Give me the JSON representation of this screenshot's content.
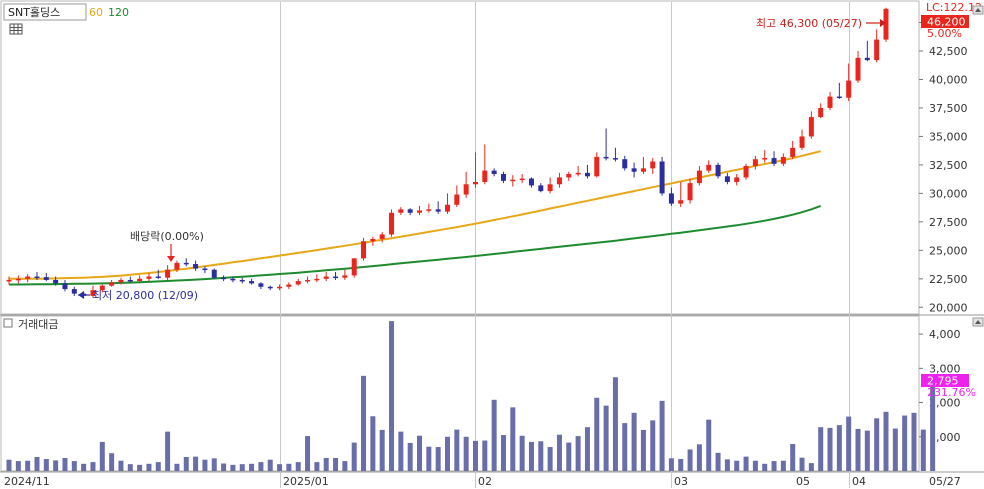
{
  "header": {
    "stock_name": "SNT홀딩스",
    "ma_labels": [
      {
        "text": "60",
        "color": "#e6a817"
      },
      {
        "text": "120",
        "color": "#1e8c2e"
      }
    ],
    "grid_icon": "table-icon"
  },
  "price_panel": {
    "lc_label": "LC:122.12",
    "current_price_tag": "46,200",
    "change_pct_tag": "5.00%",
    "high_annotation": "최고 46,300 (05/27)",
    "low_annotation": "최저 20,800 (12/09)",
    "dividend_annotation": "배당락(0.00%)"
  },
  "volume_panel": {
    "title": "거래대금",
    "current_value_tag": "2,795",
    "ratio_tag": "231.76%"
  },
  "colors": {
    "up": "#e8261e",
    "down": "#2b2f9e",
    "ma60": "#e6a817",
    "ma120": "#1e8c2e",
    "volume": "#6a6ea8",
    "tag_price": "#e8261e",
    "tag_volume": "#ee22ee"
  },
  "chart_data": [
    {
      "type": "candlestick",
      "title": "SNT홀딩스",
      "ylim": [
        19500,
        46800
      ],
      "y_ticks": [
        "20,000",
        "22,500",
        "25,000",
        "27,500",
        "30,000",
        "32,500",
        "35,000",
        "37,500",
        "40,000",
        "42,500",
        "45,000"
      ],
      "x_tick_labels": [
        "2024/11",
        "2025/01",
        "02",
        "03",
        "04",
        "05",
        "05/27"
      ],
      "series": [
        {
          "name": "60",
          "values": [
            22500,
            22500,
            22500,
            22510,
            22520,
            22540,
            22560,
            22580,
            22600,
            22630,
            22670,
            22720,
            22780,
            22850,
            22930,
            23010,
            23100,
            23190,
            23290,
            23390,
            23500,
            23600,
            23720,
            23830,
            23950,
            24060,
            24180,
            24300,
            24420,
            24540,
            24660,
            24780,
            24900,
            25020,
            25150,
            25270,
            25400,
            25530,
            25660,
            25800,
            25930,
            26060,
            26200,
            26340,
            26480,
            26620,
            26760,
            26900,
            27040,
            27190,
            27340,
            27500,
            27660,
            27820,
            27990,
            28150,
            28320,
            28490,
            28670,
            28840,
            29010,
            29180,
            29350,
            29520,
            29690,
            29860,
            30030,
            30200,
            30370,
            30540,
            30710,
            30880,
            31050,
            31220,
            31390,
            31560,
            31730,
            31900,
            32070,
            32240,
            32410,
            32580,
            32750,
            32920,
            33100,
            33300,
            33500,
            33700
          ]
        },
        {
          "name": "120",
          "values": [
            22000,
            22000,
            22010,
            22020,
            22030,
            22040,
            22050,
            22060,
            22070,
            22080,
            22100,
            22120,
            22140,
            22170,
            22200,
            22230,
            22270,
            22310,
            22350,
            22390,
            22430,
            22480,
            22530,
            22580,
            22630,
            22680,
            22740,
            22800,
            22860,
            22920,
            22980,
            23040,
            23110,
            23180,
            23250,
            23320,
            23390,
            23460,
            23540,
            23620,
            23700,
            23780,
            23860,
            23940,
            24020,
            24100,
            24180,
            24260,
            24340,
            24420,
            24500,
            24590,
            24680,
            24770,
            24860,
            24950,
            25040,
            25130,
            25220,
            25310,
            25400,
            25490,
            25580,
            25670,
            25760,
            25850,
            25950,
            26050,
            26150,
            26250,
            26350,
            26450,
            26550,
            26650,
            26760,
            26870,
            26980,
            27090,
            27200,
            27330,
            27460,
            27600,
            27760,
            27940,
            28130,
            28350,
            28600,
            28900
          ]
        }
      ],
      "candles": {
        "open": [
          22300,
          22400,
          22500,
          22700,
          22650,
          22400,
          22100,
          21600,
          21200,
          21000,
          21500,
          21900,
          22200,
          22400,
          22300,
          22500,
          22700,
          22600,
          23300,
          23900,
          23800,
          23400,
          23300,
          22600,
          22500,
          22400,
          22300,
          22100,
          21800,
          21700,
          21800,
          22000,
          22300,
          22400,
          22500,
          22700,
          22600,
          22800,
          24300,
          25800,
          26000,
          26400,
          28300,
          28600,
          28300,
          28500,
          28600,
          28400,
          29000,
          29900,
          30800,
          31000,
          32000,
          31700,
          31100,
          31200,
          31300,
          30700,
          30200,
          30800,
          31400,
          31700,
          31800,
          31500,
          33200,
          33100,
          33000,
          32200,
          31900,
          32200,
          32800,
          30000,
          29100,
          29400,
          30900,
          32000,
          32500,
          31500,
          31000,
          31400,
          32400,
          33000,
          33100,
          32600,
          33200,
          34000,
          35000,
          36700,
          37500,
          38500,
          38400,
          39900,
          41900,
          41700,
          43500
        ],
        "high": [
          22700,
          22800,
          22900,
          23100,
          23000,
          22700,
          22400,
          21800,
          21400,
          21900,
          22000,
          22400,
          22600,
          22700,
          22800,
          23000,
          23300,
          23700,
          24100,
          24300,
          24100,
          23600,
          23400,
          22800,
          22700,
          22600,
          22500,
          22200,
          21900,
          22000,
          22200,
          22500,
          22700,
          22900,
          23100,
          23100,
          23300,
          24300,
          26100,
          26200,
          26600,
          28600,
          28800,
          28700,
          28900,
          29100,
          29300,
          30000,
          30700,
          31900,
          33600,
          34300,
          32200,
          31900,
          31600,
          31700,
          31400,
          30900,
          31400,
          31800,
          31900,
          32400,
          32500,
          33600,
          35700,
          34000,
          33300,
          32700,
          33200,
          33100,
          33200,
          30500,
          31000,
          31300,
          32400,
          32900,
          32700,
          31800,
          31700,
          32600,
          33300,
          33800,
          33700,
          33500,
          34600,
          35600,
          37200,
          37900,
          38900,
          39700,
          41400,
          42500,
          43400,
          44400,
          46300
        ],
        "low": [
          22000,
          22100,
          22200,
          22400,
          22300,
          21900,
          21400,
          21000,
          20800,
          20900,
          21300,
          21800,
          22000,
          22200,
          22100,
          22300,
          22500,
          22400,
          23100,
          23600,
          23200,
          23000,
          22500,
          22300,
          22200,
          22100,
          22000,
          21600,
          21500,
          21500,
          21600,
          21900,
          22100,
          22200,
          22300,
          22400,
          22400,
          22600,
          24100,
          25400,
          25700,
          26200,
          28100,
          28100,
          28100,
          28300,
          28200,
          28200,
          28800,
          29600,
          30500,
          30800,
          31500,
          30900,
          30600,
          30900,
          30500,
          30100,
          30000,
          30500,
          31100,
          31500,
          31300,
          31400,
          32900,
          32800,
          32000,
          31400,
          31700,
          31700,
          29800,
          28900,
          28800,
          29100,
          30700,
          31800,
          31300,
          30800,
          30700,
          31200,
          32100,
          32700,
          32400,
          32400,
          33000,
          33800,
          34800,
          36600,
          37300,
          38300,
          38100,
          39700,
          41600,
          41500,
          43300
        ],
        "close": [
          22400,
          22500,
          22700,
          22650,
          22400,
          22100,
          21600,
          21200,
          21000,
          21500,
          21900,
          22200,
          22400,
          22300,
          22500,
          22700,
          22600,
          23300,
          23900,
          23800,
          23400,
          23300,
          22600,
          22500,
          22400,
          22300,
          22100,
          21800,
          21700,
          21800,
          22000,
          22300,
          22400,
          22500,
          22700,
          22600,
          22800,
          24300,
          25800,
          26000,
          26400,
          28300,
          28600,
          28300,
          28500,
          28600,
          28400,
          29000,
          29900,
          30800,
          31000,
          32000,
          31700,
          31100,
          31200,
          31300,
          30700,
          30200,
          30800,
          31400,
          31700,
          31800,
          31500,
          33200,
          33100,
          33000,
          32200,
          31900,
          32200,
          32800,
          30000,
          29100,
          29400,
          30900,
          32000,
          32500,
          31500,
          31000,
          31400,
          32400,
          33000,
          33100,
          32600,
          33200,
          34000,
          35000,
          36700,
          37500,
          38500,
          38400,
          39900,
          41900,
          41700,
          43500,
          46200
        ]
      }
    },
    {
      "type": "bar",
      "title": "거래대금",
      "ylim": [
        0,
        4500
      ],
      "y_ticks": [
        "1,000",
        "2,000",
        "3,000",
        "4,000"
      ],
      "values": [
        330,
        290,
        300,
        410,
        350,
        310,
        380,
        290,
        210,
        260,
        850,
        520,
        300,
        200,
        180,
        210,
        260,
        1150,
        210,
        410,
        420,
        330,
        370,
        220,
        180,
        200,
        210,
        260,
        330,
        200,
        210,
        260,
        1020,
        260,
        380,
        380,
        290,
        830,
        2780,
        1600,
        1200,
        4380,
        1150,
        820,
        1030,
        710,
        700,
        1000,
        1210,
        1000,
        880,
        890,
        2080,
        1050,
        1860,
        1030,
        850,
        870,
        700,
        1060,
        830,
        1020,
        1280,
        2140,
        1910,
        2740,
        1400,
        1700,
        1200,
        1480,
        2050,
        370,
        350,
        630,
        780,
        1500,
        530,
        340,
        300,
        420,
        300,
        210,
        290,
        300,
        790,
        390,
        230,
        1280,
        1260,
        1340,
        1590,
        1230,
        1180,
        1540,
        1730,
        1240,
        1620,
        1700,
        1210,
        2795
      ]
    }
  ]
}
